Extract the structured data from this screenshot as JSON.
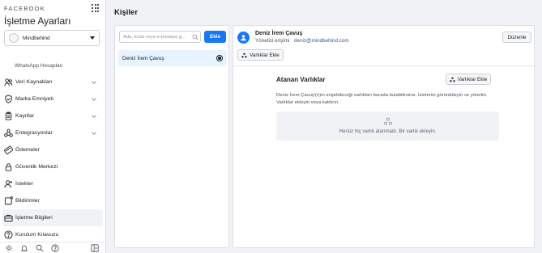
{
  "sidebar": {
    "brand": "FACEBOOK",
    "title": "İşletme Ayarları",
    "account": "Mindbehind",
    "whatsapp": "WhatsApp Hesapları",
    "items": [
      {
        "label": "Veri Kaynakları",
        "icon": "people-icon",
        "chevron": true
      },
      {
        "label": "Marka Emniyeti",
        "icon": "shield-icon",
        "chevron": true
      },
      {
        "label": "Kayıtlar",
        "icon": "clipboard-icon",
        "chevron": true
      },
      {
        "label": "Entegrasyonlar",
        "icon": "integrations-icon",
        "chevron": true
      },
      {
        "label": "Ödemeler",
        "icon": "card-icon",
        "chevron": false
      },
      {
        "label": "Güvenlik Merkezi",
        "icon": "lock-icon",
        "chevron": false
      },
      {
        "label": "İstekler",
        "icon": "person-add-icon",
        "chevron": false
      },
      {
        "label": "Bildirimler",
        "icon": "notification-icon",
        "chevron": false
      },
      {
        "label": "İşletme Bilgileri",
        "icon": "briefcase-icon",
        "chevron": false,
        "active": true
      },
      {
        "label": "Kurulum Kılavuzu",
        "icon": "help-icon",
        "chevron": false
      }
    ]
  },
  "page": {
    "title": "Kişiler"
  },
  "list": {
    "search_placeholder": "Ada, koda veya e-postaya g...",
    "add_label": "Ekle",
    "people": [
      {
        "name": "Deniz İrem Çavuş",
        "selected": true
      }
    ]
  },
  "detail": {
    "name": "Deniz İrem Çavuş",
    "role": "Yönetici erişimi",
    "email": "deniz@mindbehind.com",
    "edit_label": "Düzenle",
    "assets_add_label": "Varlıklar Ekle",
    "section_title": "Atanan Varlıklar",
    "section_add_label": "Varlıklar Ekle",
    "description": "Deniz İrem Çavuş'(n)in erişebileceği varlıkları burada bulabilirsiniz. İzinlerini görüntüleyin ve yönetin. Varlıklar ekleyin veya kaldırın.",
    "empty_text": "Henüz hiç varlık atanmadı. Bir varlık ekleyin."
  },
  "colors": {
    "accent": "#1877f2",
    "selected_row": "#e7f3ff",
    "link": "#385898"
  }
}
